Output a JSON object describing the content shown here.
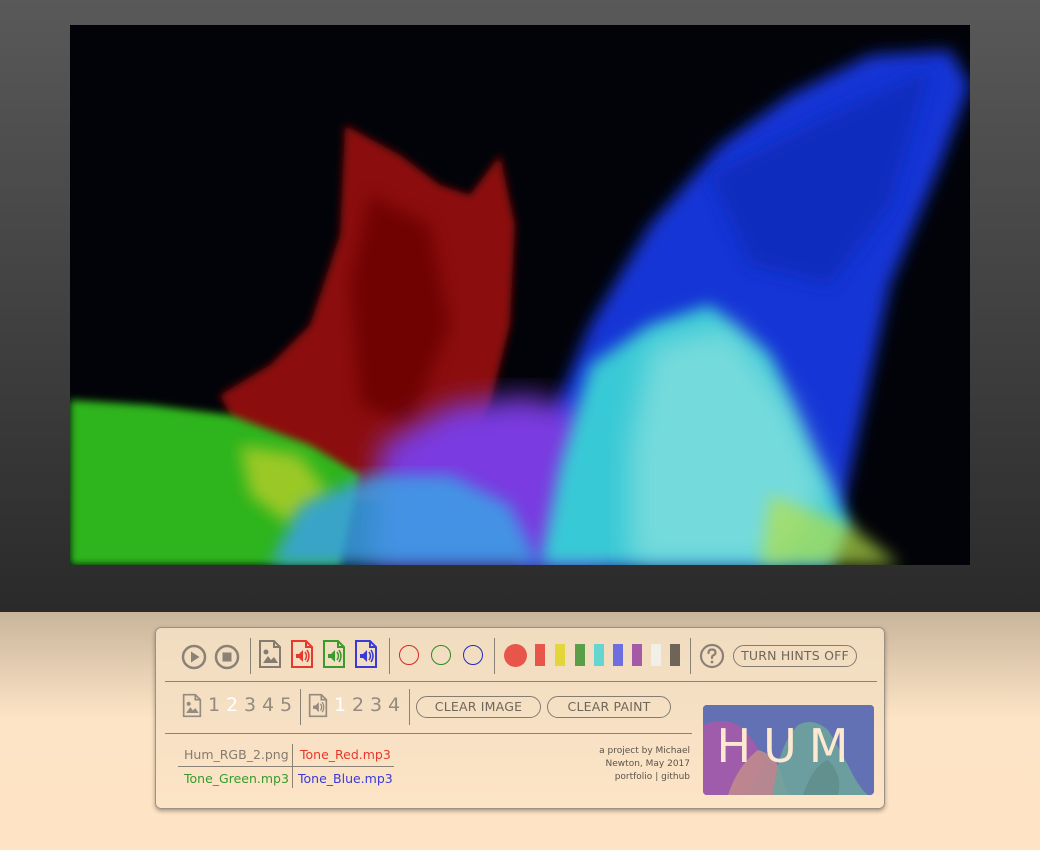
{
  "controls": {
    "play_icon": "play-circle-icon",
    "stop_icon": "stop-circle-icon",
    "image_file_icon": "image-file-icon",
    "audio_files": [
      {
        "icon": "audio-file-icon",
        "color": "#e8382e"
      },
      {
        "icon": "audio-file-icon",
        "color": "#3a9a2c"
      },
      {
        "icon": "audio-file-icon",
        "color": "#3a3ad8"
      }
    ],
    "brush_rings": [
      "#d82828",
      "#2f8a24",
      "#2828c8"
    ],
    "brush_swatches": [
      "#e8564b",
      "#e8564b",
      "#e3d63a",
      "#5a9e48",
      "#64d6cf",
      "#6e6ee0",
      "#a55aa8",
      "#f2f0e6",
      "#6e6457"
    ],
    "help_icon": "question-circle-icon",
    "hints_button": "TURN HINTS OFF",
    "image_presets": [
      "1",
      "2",
      "3",
      "4",
      "5"
    ],
    "image_active": 1,
    "audio_presets": [
      "1",
      "2",
      "3",
      "4"
    ],
    "audio_active": 0,
    "clear_image": "CLEAR IMAGE",
    "clear_paint": "CLEAR PAINT"
  },
  "files": {
    "image": "Hum_RGB_2.png",
    "red": "Tone_Red.mp3",
    "green": "Tone_Green.mp3",
    "blue": "Tone_Blue.mp3"
  },
  "colors": {
    "image_file": "#857b70",
    "red": "#e8382e",
    "green": "#3a9a2c",
    "blue": "#3a3ad8"
  },
  "credits": {
    "line1": "a project by Michael",
    "line2": "Newton, May 2017",
    "portfolio": "portfolio",
    "separator": "|",
    "github": "github"
  },
  "logo": {
    "text": "HUM"
  }
}
